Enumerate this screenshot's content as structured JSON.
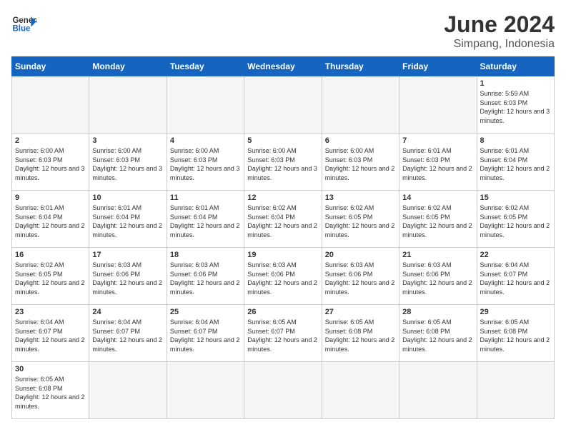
{
  "logo": {
    "text_general": "General",
    "text_blue": "Blue"
  },
  "header": {
    "month": "June 2024",
    "location": "Simpang, Indonesia"
  },
  "weekdays": [
    "Sunday",
    "Monday",
    "Tuesday",
    "Wednesday",
    "Thursday",
    "Friday",
    "Saturday"
  ],
  "weeks": [
    [
      {
        "day": "",
        "empty": true
      },
      {
        "day": "",
        "empty": true
      },
      {
        "day": "",
        "empty": true
      },
      {
        "day": "",
        "empty": true
      },
      {
        "day": "",
        "empty": true
      },
      {
        "day": "",
        "empty": true
      },
      {
        "day": "1",
        "sunrise": "5:59 AM",
        "sunset": "6:03 PM",
        "daylight": "12 hours and 3 minutes."
      }
    ],
    [
      {
        "day": "2",
        "sunrise": "6:00 AM",
        "sunset": "6:03 PM",
        "daylight": "12 hours and 3 minutes."
      },
      {
        "day": "3",
        "sunrise": "6:00 AM",
        "sunset": "6:03 PM",
        "daylight": "12 hours and 3 minutes."
      },
      {
        "day": "4",
        "sunrise": "6:00 AM",
        "sunset": "6:03 PM",
        "daylight": "12 hours and 3 minutes."
      },
      {
        "day": "5",
        "sunrise": "6:00 AM",
        "sunset": "6:03 PM",
        "daylight": "12 hours and 3 minutes."
      },
      {
        "day": "6",
        "sunrise": "6:00 AM",
        "sunset": "6:03 PM",
        "daylight": "12 hours and 2 minutes."
      },
      {
        "day": "7",
        "sunrise": "6:01 AM",
        "sunset": "6:03 PM",
        "daylight": "12 hours and 2 minutes."
      },
      {
        "day": "8",
        "sunrise": "6:01 AM",
        "sunset": "6:04 PM",
        "daylight": "12 hours and 2 minutes."
      }
    ],
    [
      {
        "day": "9",
        "sunrise": "6:01 AM",
        "sunset": "6:04 PM",
        "daylight": "12 hours and 2 minutes."
      },
      {
        "day": "10",
        "sunrise": "6:01 AM",
        "sunset": "6:04 PM",
        "daylight": "12 hours and 2 minutes."
      },
      {
        "day": "11",
        "sunrise": "6:01 AM",
        "sunset": "6:04 PM",
        "daylight": "12 hours and 2 minutes."
      },
      {
        "day": "12",
        "sunrise": "6:02 AM",
        "sunset": "6:04 PM",
        "daylight": "12 hours and 2 minutes."
      },
      {
        "day": "13",
        "sunrise": "6:02 AM",
        "sunset": "6:05 PM",
        "daylight": "12 hours and 2 minutes."
      },
      {
        "day": "14",
        "sunrise": "6:02 AM",
        "sunset": "6:05 PM",
        "daylight": "12 hours and 2 minutes."
      },
      {
        "day": "15",
        "sunrise": "6:02 AM",
        "sunset": "6:05 PM",
        "daylight": "12 hours and 2 minutes."
      }
    ],
    [
      {
        "day": "16",
        "sunrise": "6:02 AM",
        "sunset": "6:05 PM",
        "daylight": "12 hours and 2 minutes."
      },
      {
        "day": "17",
        "sunrise": "6:03 AM",
        "sunset": "6:06 PM",
        "daylight": "12 hours and 2 minutes."
      },
      {
        "day": "18",
        "sunrise": "6:03 AM",
        "sunset": "6:06 PM",
        "daylight": "12 hours and 2 minutes."
      },
      {
        "day": "19",
        "sunrise": "6:03 AM",
        "sunset": "6:06 PM",
        "daylight": "12 hours and 2 minutes."
      },
      {
        "day": "20",
        "sunrise": "6:03 AM",
        "sunset": "6:06 PM",
        "daylight": "12 hours and 2 minutes."
      },
      {
        "day": "21",
        "sunrise": "6:03 AM",
        "sunset": "6:06 PM",
        "daylight": "12 hours and 2 minutes."
      },
      {
        "day": "22",
        "sunrise": "6:04 AM",
        "sunset": "6:07 PM",
        "daylight": "12 hours and 2 minutes."
      }
    ],
    [
      {
        "day": "23",
        "sunrise": "6:04 AM",
        "sunset": "6:07 PM",
        "daylight": "12 hours and 2 minutes."
      },
      {
        "day": "24",
        "sunrise": "6:04 AM",
        "sunset": "6:07 PM",
        "daylight": "12 hours and 2 minutes."
      },
      {
        "day": "25",
        "sunrise": "6:04 AM",
        "sunset": "6:07 PM",
        "daylight": "12 hours and 2 minutes."
      },
      {
        "day": "26",
        "sunrise": "6:05 AM",
        "sunset": "6:07 PM",
        "daylight": "12 hours and 2 minutes."
      },
      {
        "day": "27",
        "sunrise": "6:05 AM",
        "sunset": "6:08 PM",
        "daylight": "12 hours and 2 minutes."
      },
      {
        "day": "28",
        "sunrise": "6:05 AM",
        "sunset": "6:08 PM",
        "daylight": "12 hours and 2 minutes."
      },
      {
        "day": "29",
        "sunrise": "6:05 AM",
        "sunset": "6:08 PM",
        "daylight": "12 hours and 2 minutes."
      }
    ],
    [
      {
        "day": "30",
        "sunrise": "6:05 AM",
        "sunset": "6:08 PM",
        "daylight": "12 hours and 2 minutes.",
        "last": true
      },
      {
        "day": "",
        "empty": true,
        "last": true
      },
      {
        "day": "",
        "empty": true,
        "last": true
      },
      {
        "day": "",
        "empty": true,
        "last": true
      },
      {
        "day": "",
        "empty": true,
        "last": true
      },
      {
        "day": "",
        "empty": true,
        "last": true
      },
      {
        "day": "",
        "empty": true,
        "last": true
      }
    ]
  ]
}
